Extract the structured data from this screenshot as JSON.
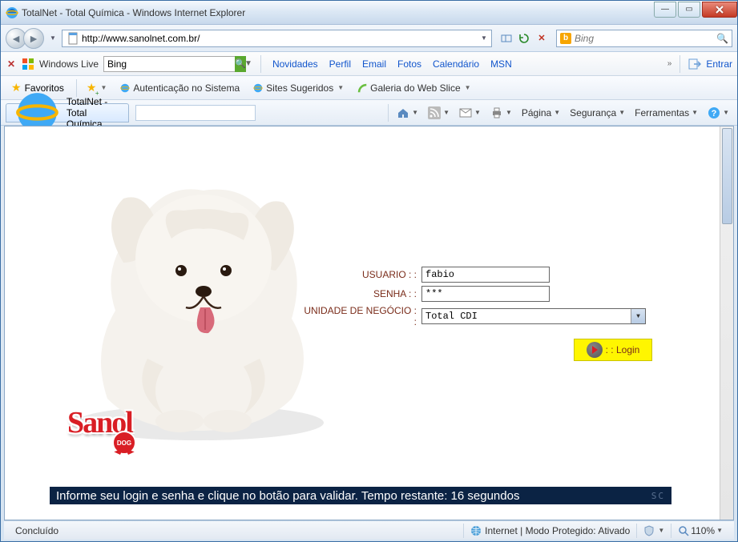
{
  "window": {
    "title": "TotalNet - Total Química - Windows Internet Explorer"
  },
  "nav": {
    "url": "http://www.sanolnet.com.br/",
    "search_placeholder": "Bing"
  },
  "wlbar": {
    "brand": "Windows Live",
    "search_value": "Bing",
    "links": {
      "novidades": "Novidades",
      "perfil": "Perfil",
      "email": "Email",
      "fotos": "Fotos",
      "calendario": "Calendário",
      "msn": "MSN"
    },
    "entrar": "Entrar"
  },
  "favbar": {
    "favoritos": "Favoritos",
    "auth": "Autenticação no Sistema",
    "sites": "Sites Sugeridos",
    "gallery": "Galeria do Web Slice"
  },
  "cmdbar": {
    "tab_title": "TotalNet - Total Química",
    "pagina": "Página",
    "seguranca": "Segurança",
    "ferramentas": "Ferramentas"
  },
  "form": {
    "usuario_label": "USUARIO : :",
    "usuario_value": "fabio",
    "senha_label": "SENHA : :",
    "senha_value": "***",
    "unidade_label": "UNIDADE DE NEGÓCIO : :",
    "unidade_value": "Total CDI",
    "login_label": ": : Login"
  },
  "logo": {
    "brand": "Sanol",
    "badge": "DOG"
  },
  "infobar": {
    "text": "Informe seu login e senha e clique no botão para validar. Tempo restante: 16 segundos",
    "trail": "SC"
  },
  "statusbar": {
    "status": "Concluído",
    "zone": "Internet | Modo Protegido: Ativado",
    "zoom": "110%"
  },
  "chart_data": null
}
